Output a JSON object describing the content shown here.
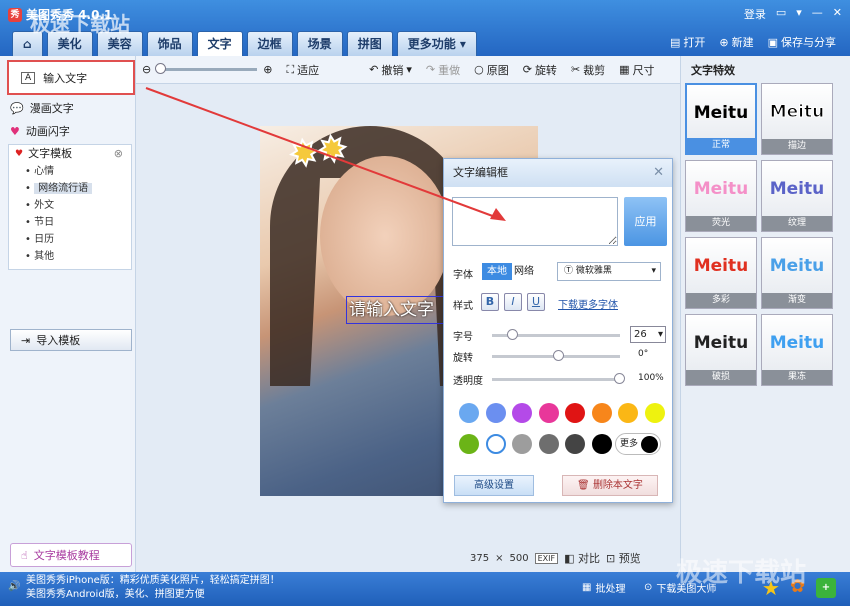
{
  "app": {
    "title": "美图秀秀 4.0.1",
    "logo": "秀"
  },
  "window": {
    "login": "登录",
    "controls": [
      "message-icon",
      "menu-icon",
      "minimize-icon",
      "close-icon"
    ]
  },
  "tabs": [
    {
      "label": "美化"
    },
    {
      "label": "美容"
    },
    {
      "label": "饰品"
    },
    {
      "label": "文字"
    },
    {
      "label": "边框"
    },
    {
      "label": "场景"
    },
    {
      "label": "拼图"
    },
    {
      "label": "更多功能"
    }
  ],
  "active_tab": "文字",
  "top_actions": {
    "open": "打开",
    "new": "新建",
    "save": "保存与分享"
  },
  "toolbar": {
    "fit": "适应",
    "undo": "撤销",
    "redo": "重做",
    "original": "原图",
    "rotate": "旋转",
    "crop": "裁剪",
    "resize": "尺寸"
  },
  "left": {
    "input_text": "输入文字",
    "comic_text": "漫画文字",
    "animated_text": "动画闪字",
    "template": "文字模板",
    "template_items": [
      "心情",
      "网络流行语",
      "外文",
      "节日",
      "日历",
      "其他"
    ],
    "selected_template": "网络流行语",
    "import": "导入模板",
    "tutorial": "文字模板教程"
  },
  "canvas": {
    "placeholder_text": "请输入文字",
    "width": "375",
    "x": "×",
    "height": "500",
    "exif": "EXIF",
    "compare": "对比",
    "preview": "预览"
  },
  "dialog": {
    "title": "文字编辑框",
    "apply": "应用",
    "font_label": "字体",
    "font_local": "本地",
    "font_net": "网络",
    "font_name": "Ⓣ 微软雅黑",
    "style_label": "样式",
    "bold": "B",
    "italic": "I",
    "underline": "U",
    "more_fonts": "下载更多字体",
    "size_label": "字号",
    "size_value": "26",
    "size_level": 0.12,
    "rotate_label": "旋转",
    "rotate_value": "0°",
    "rotate_level": 0.5,
    "opacity_label": "透明度",
    "opacity_value": "100%",
    "opacity_level": 1.0,
    "more_colors": "更多",
    "advanced": "高级设置",
    "delete": "删除本文字"
  },
  "colors": [
    "#6aa8f0",
    "#6b8ff0",
    "#b44ae8",
    "#e8379a",
    "#e01414",
    "#f7861b",
    "#fbb715",
    "#eef20f",
    "#6bb417",
    "#ffffff",
    "#9d9d9d",
    "#6e6e6e",
    "#444444",
    "#000000"
  ],
  "right": {
    "title": "文字特效",
    "sample": "Meitu",
    "effects": [
      {
        "name": "正常",
        "color": "#000000"
      },
      {
        "name": "描边",
        "color": "#000000"
      },
      {
        "name": "荧光",
        "color": "#f490c8"
      },
      {
        "name": "纹理",
        "color": "#5b63c8"
      },
      {
        "name": "多彩",
        "color": "#e03020"
      },
      {
        "name": "渐变",
        "color": "#4aa0e8"
      },
      {
        "name": "破损",
        "color": "#222222"
      },
      {
        "name": "果冻",
        "color": "#3fa0f0"
      }
    ]
  },
  "status": {
    "ticker_line1": "美图秀秀iPhone版：精彩优质美化照片，轻松搞定拼图！",
    "ticker_line2": "美图秀秀Android版，美化、拼图更方便",
    "batch": "批处理",
    "download": "下载美图大师"
  },
  "watermark": {
    "top": "极速下载站",
    "bottom": "极速下载站"
  }
}
